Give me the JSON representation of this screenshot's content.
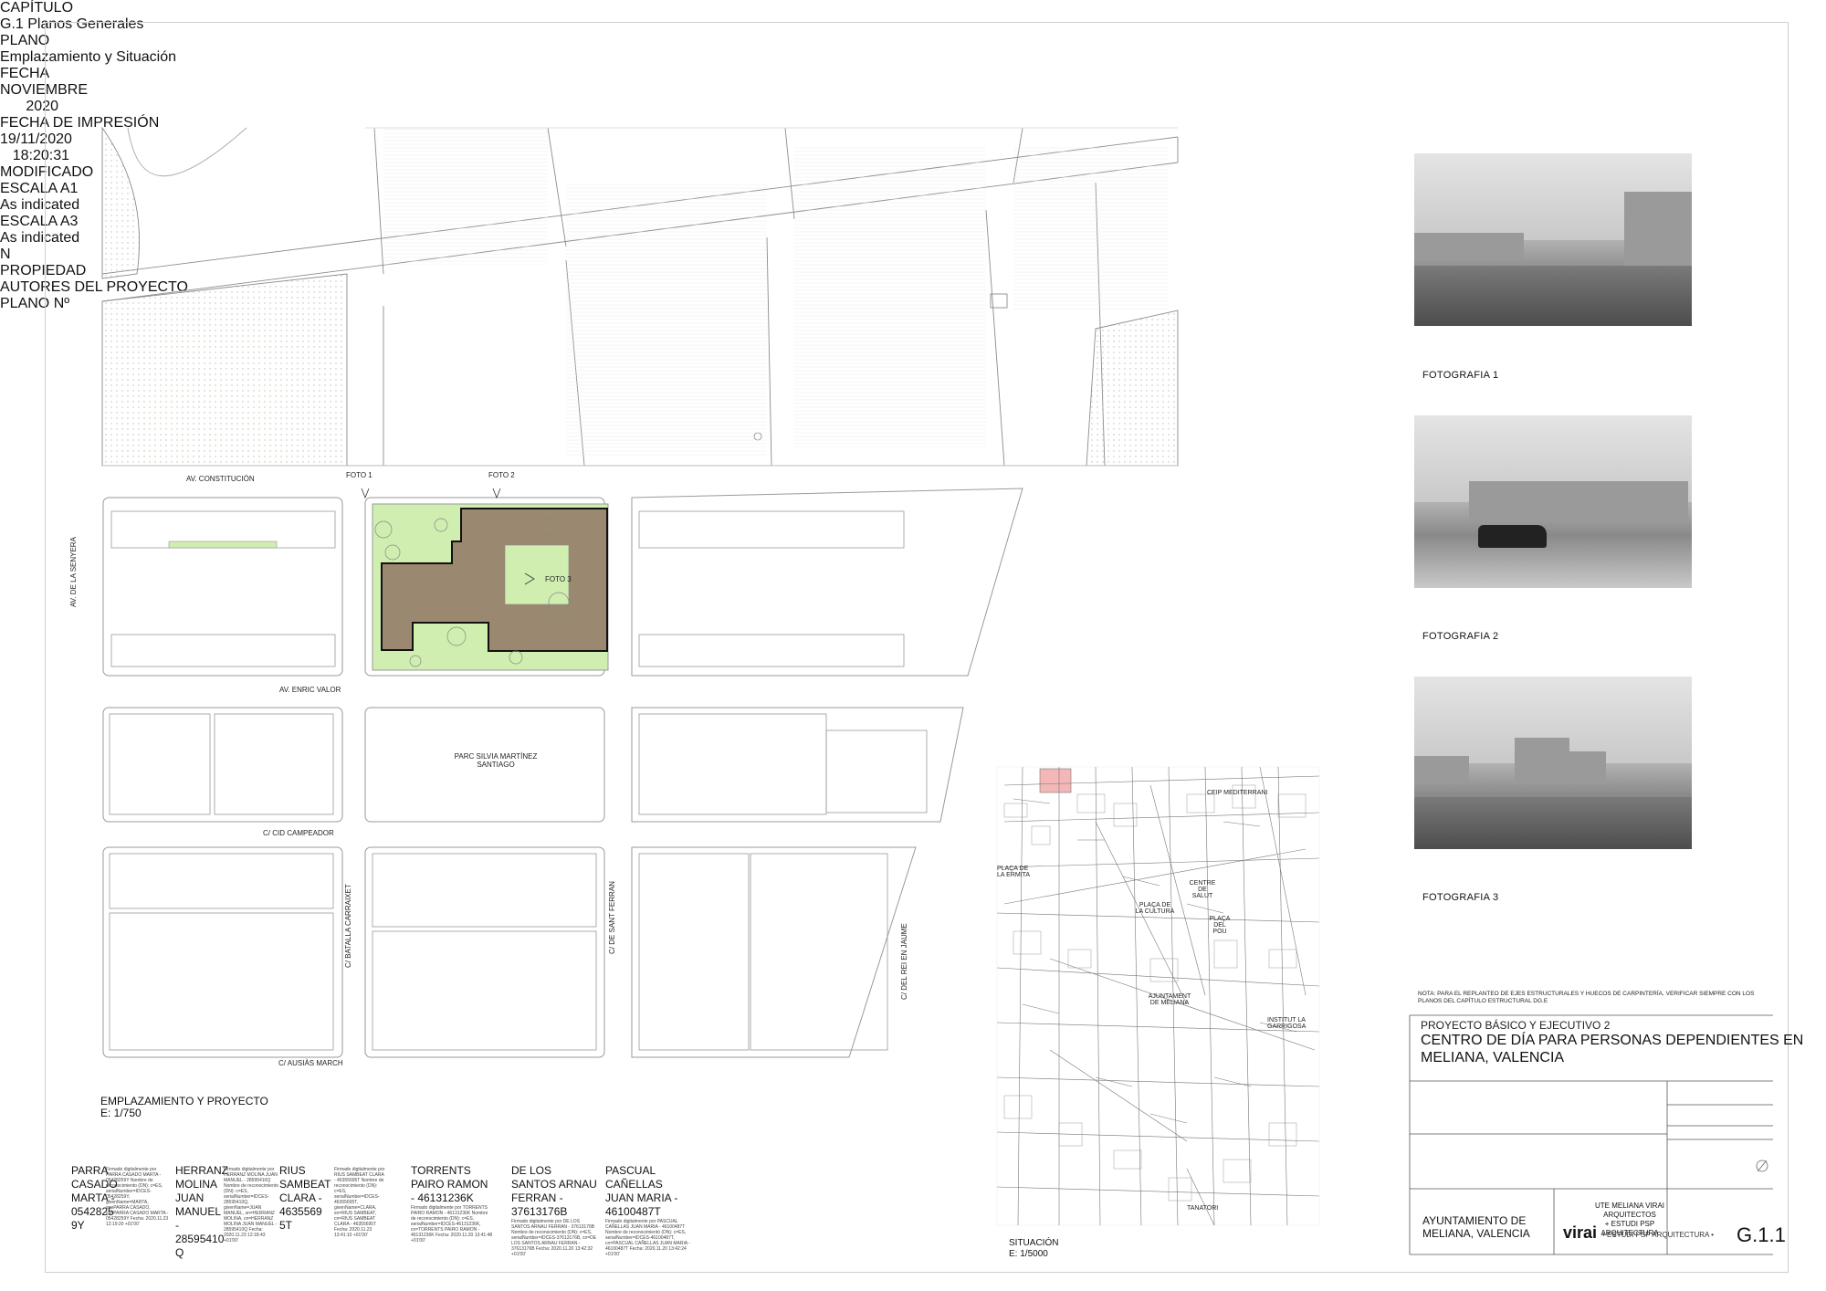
{
  "site_plan": {
    "streets": {
      "av_constitucion": "AV. CONSTITUCIÓN",
      "av_senyera": "AV. DE LA SENYERA",
      "av_enric_valor": "AV. ENRIC VALOR",
      "c_cid_campeador": "C/ CID CAMPEADOR",
      "c_ausias_march": "C/ AUSIÀS MARCH",
      "c_batalla_carraixet": "C/ BATALLA CARRAIXET",
      "c_sant_ferran": "C/ DE SANT FERRAN",
      "c_rei_en_jaume": "C/ DEL REI EN JAUME"
    },
    "park_label_1": "PARC SILVIA MARTÍNEZ",
    "park_label_2": "SANTIAGO",
    "foto1": "FOTO 1",
    "foto2": "FOTO 2",
    "foto3": "FOTO 3",
    "title": "EMPLAZAMIENTO Y PROYECTO",
    "scale": "E: 1/750",
    "colors": {
      "building": "#9a8870",
      "green": "#cfeeb0",
      "outline": "#9a9a9a"
    }
  },
  "situation": {
    "labels": {
      "ceip": "CEIP MEDITERRANI",
      "placa_ermita": "PLAÇA DE LA ERMITA",
      "placa_cultura": "PLAÇA DE LA CULTURA",
      "centre_salut": "CENTRE DE SALUT",
      "placa_pou": "PLAÇA DEL POU",
      "ajuntament": "AJUNTAMENT DE MELIANA",
      "institut": "INSTITUT LA GARRIGOSA",
      "tanatori": "TANATORI"
    },
    "title": "SITUACIÓN",
    "scale": "E: 1/5000"
  },
  "photos": [
    {
      "caption": "FOTOGRAFIA 1"
    },
    {
      "caption": "FOTOGRAFIA 2"
    },
    {
      "caption": "FOTOGRAFIA 3"
    }
  ],
  "note": "NOTA: PARA EL REPLANTEO DE EJES ESTRUCTURALES Y HUECOS DE CARPINTERÍA, VERIFICAR SIEMPRE CON LOS PLANOS DEL CAPÍTULO ESTRUCTURAL DG.E",
  "title_block": {
    "project_type": "PROYECTO BÁSICO Y EJECUTIVO 2",
    "project_title_1": "CENTRO DE DÍA PARA PERSONAS DEPENDIENTES EN",
    "project_title_2": "MELIANA, VALENCIA",
    "capitulo_label": "CAPÍTULO",
    "capitulo_value": "G.1 Planos Generales",
    "fecha_label": "FECHA",
    "fecha_value": "NOVIEMBRE 2020",
    "fecha_impresion_label": "FECHA DE IMPRESIÓN",
    "fecha_impresion_value": "19/11/2020 18:20:31",
    "modificado_label": "MODIFICADO",
    "plano_label": "PLANO",
    "plano_value": "Emplazamiento y Situación",
    "escala_a1_label": "ESCALA A1",
    "escala_a1_value": "As indicated",
    "escala_a3_label": "ESCALA A3",
    "escala_a3_value": "As indicated",
    "north": "N",
    "propiedad_label": "PROPIEDAD",
    "propiedad_1": "AYUNTAMIENTO DE",
    "propiedad_2": "MELIANA, VALENCIA",
    "autores_label": "AUTORES DEL PROYECTO",
    "autores_1": "UTE MELIANA VIRAI ARQUITECTOS",
    "autores_2": "+ ESTUDI PSP ARQUITECTURA",
    "logo_virai": "virai",
    "logo_psp": "• ESTUDI PSP ARQUITECTURA •",
    "plano_no_label": "PLANO Nº",
    "plano_no_value": "G.1.1"
  },
  "signatures": [
    {
      "name": "PARRA CASADO MARTA - 0542825 9Y",
      "fine": "Firmado digitalmente por PARRA CASADO MARTA - 05428259Y Nombre de reconocimiento (DN): c=ES, serialNumber=IDCES-05428259Y, givenName=MARTA, sn=PARRA CASADO, cn=PARRA CASADO MARTA - 05428259Y Fecha: 2020.11.23 12:19:20 +01'00'"
    },
    {
      "name": "HERRANZ MOLINA JUAN MANUEL - 28595410 Q",
      "fine": "Firmado digitalmente por HERRANZ MOLINA JUAN MANUEL - 28595410Q Nombre de reconocimiento (DN): c=ES, serialNumber=IDCES-28595410Q, givenName=JUAN MANUEL, sn=HERRANZ MOLINA, cn=HERRANZ MOLINA JUAN MANUEL - 28595410Q Fecha: 2020.11.23 12:18:43 +01'00'"
    },
    {
      "name": "RIUS SAMBEAT CLARA - 4635569 5T",
      "fine": "Firmado digitalmente por RIUS SAMBEAT CLARA - 46355695T Nombre de reconocimiento (DN): c=ES, serialNumber=IDCES-46355695T, givenName=CLARA, sn=RIUS SAMBEAT, cn=RIUS SAMBEAT CLARA - 46355695T Fecha: 2020.11.23 13:41:10 +01'00'"
    },
    {
      "name": "TORRENTS PAIRO RAMON - 46131236K",
      "fine": "Firmado digitalmente por TORRENTS PAIRO RAMON - 46131236K Nombre de reconocimiento (DN): c=ES, serialNumber=IDCES-46131236K, cn=TORRENTS PAIRO RAMON - 46131236K Fecha: 2020.11.20 13:41:48 +01'00'"
    },
    {
      "name": "DE LOS SANTOS ARNAU FERRAN - 37613176B",
      "fine": "Firmado digitalmente por DE LOS SANTOS ARNAU FERRAN - 37613176B Nombre de reconocimiento (DN): c=ES, serialNumber=IDCES-37613176B, cn=DE LOS SANTOS ARNAU FERRAN - 37613176B Fecha: 2020.11.20 13:42:32 +01'00'"
    },
    {
      "name": "PASCUAL CAÑELLAS JUAN MARIA - 46100487T",
      "fine": "Firmado digitalmente por PASCUAL CAÑELLAS JUAN MARIA - 46100487T Nombre de reconocimiento (DN): c=ES, serialNumber=IDCES-46100487T, cn=PASCUAL CAÑELLAS JUAN MARIA - 46100487T Fecha: 2020.11.20 13:42:24 +01'00'"
    }
  ]
}
